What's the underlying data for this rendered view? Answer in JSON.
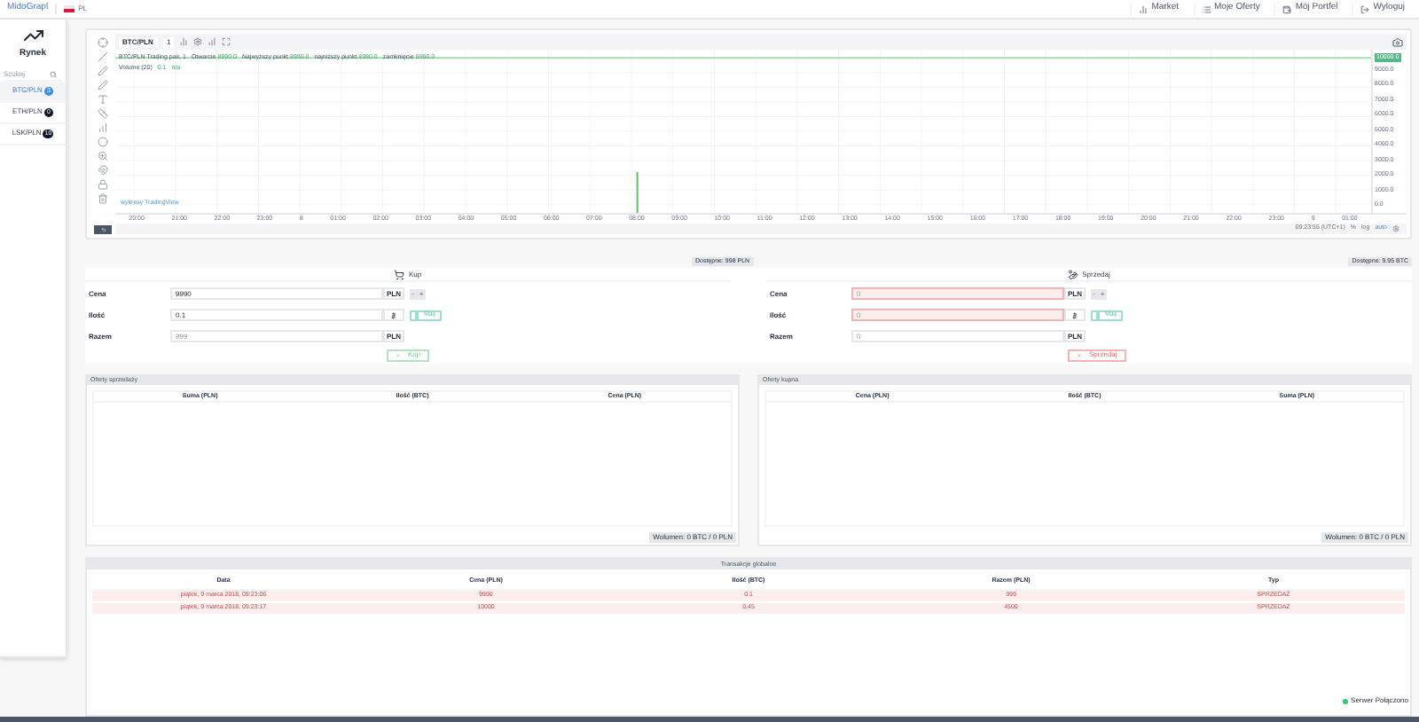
{
  "header": {
    "brand": "MidoGrapl",
    "language": "PL",
    "nav": [
      {
        "label": "Market"
      },
      {
        "label": "Moje Oferty"
      },
      {
        "label": "Mój Portfel"
      },
      {
        "label": "Wyloguj"
      }
    ]
  },
  "sidebar": {
    "title": "Rynek",
    "search": {
      "placeholder": "Szukaj"
    },
    "markets": [
      {
        "label": "BTC/PLN",
        "badge": "3",
        "selected": true
      },
      {
        "label": "ETH/PLN",
        "badge": "0",
        "selected": false
      },
      {
        "label": "LSK/PLN",
        "badge": "10",
        "selected": false
      }
    ]
  },
  "chart": {
    "symbol": "BTC/PLN",
    "interval": "1",
    "legend_title": "BTC/PLN Trading pair, 1",
    "legend": [
      {
        "label": "Otwarcie",
        "value": "8990.0"
      },
      {
        "label": "Najwyższy punkt",
        "value": "8990.0"
      },
      {
        "label": "najniższy punkt",
        "value": "8990.0"
      },
      {
        "label": "zamknięcie",
        "value": "8990.0"
      }
    ],
    "volume_label": "Volume (20)",
    "volume_values": [
      "0.1",
      "n/a"
    ],
    "watermark": "wykresy TradingView",
    "price_tag": "10000.0",
    "y_labels": [
      "9000.0",
      "8000.0",
      "7000.0",
      "6000.0",
      "5000.0",
      "4000.0",
      "3000.0",
      "2000.0",
      "1000.0",
      "0.0"
    ],
    "x_labels": [
      "20:00",
      "21:00",
      "22:00",
      "23:00",
      "8",
      "01:00",
      "02:00",
      "03:00",
      "04:00",
      "05:00",
      "06:00",
      "07:00",
      "08:00",
      "09:00",
      "10:00",
      "11:00",
      "12:00",
      "13:00",
      "14:00",
      "15:00",
      "16:00",
      "17:00",
      "18:00",
      "19:00",
      "20:00",
      "21:00",
      "22:00",
      "23:00",
      "9",
      "01:00"
    ],
    "time": "09:23:55 (UTC+1)",
    "scale_buttons": [
      {
        "label": "%",
        "selected": false
      },
      {
        "label": "log",
        "selected": false
      },
      {
        "label": "auto",
        "selected": true
      }
    ]
  },
  "balances": [
    "Dostępne: 998 PLN",
    "Dostępne: 9.95 BTC"
  ],
  "forms": [
    {
      "kind": "buy",
      "title": "Kup",
      "button": "Kup",
      "max_label": "Max",
      "max_on": false,
      "stepper": [
        "-",
        "+"
      ],
      "fields": [
        {
          "kind": "price",
          "label": "Cena",
          "value": "9990",
          "unit": "PLN",
          "invalid": false
        },
        {
          "kind": "amount",
          "label": "Ilość",
          "value": "0.1",
          "invalid": false
        },
        {
          "kind": "total",
          "label": "Razem",
          "placeholder": "999",
          "unit": "PLN",
          "invalid": false
        }
      ]
    },
    {
      "kind": "sell",
      "title": "Sprzedaj",
      "button": "Sprzedaj",
      "max_label": "Max",
      "max_on": false,
      "stepper": [
        "-",
        "+"
      ],
      "fields": [
        {
          "kind": "price",
          "label": "Cena",
          "placeholder": "0",
          "unit": "PLN",
          "invalid": true
        },
        {
          "kind": "amount",
          "label": "Ilość",
          "placeholder": "0",
          "invalid": true
        },
        {
          "kind": "total",
          "label": "Razem",
          "placeholder": "0",
          "unit": "PLN",
          "invalid": false
        }
      ]
    }
  ],
  "order_books": [
    {
      "title": "Oferty sprzedaży",
      "columns": [
        "Suma (PLN)",
        "Ilość (BTC)",
        "Cena (PLN)"
      ],
      "footer": "Wolumen: 0 BTC / 0 PLN"
    },
    {
      "title": "Oferty kupna",
      "columns": [
        "Cena (PLN)",
        "Ilość (BTC)",
        "Suma (PLN)"
      ],
      "footer": "Wolumen: 0 BTC / 0 PLN"
    }
  ],
  "transactions": {
    "title": "Transakcje globalne",
    "columns": [
      "Data",
      "Cena (PLN)",
      "Ilość (BTC)",
      "Razem (PLN)",
      "Typ"
    ],
    "rows": [
      {
        "kind": "sell",
        "cells": [
          "piątek, 9 marca 2018, 09:23:06",
          "9990",
          "0.1",
          "999",
          "SPRZEDAŻ"
        ]
      },
      {
        "kind": "sell",
        "cells": [
          "piątek, 9 marca 2018, 09:23:17",
          "10000",
          "0.45",
          "4500",
          "SPRZEDAŻ"
        ]
      }
    ]
  },
  "status": {
    "label": "Serwer Połączono",
    "connected": true
  }
}
